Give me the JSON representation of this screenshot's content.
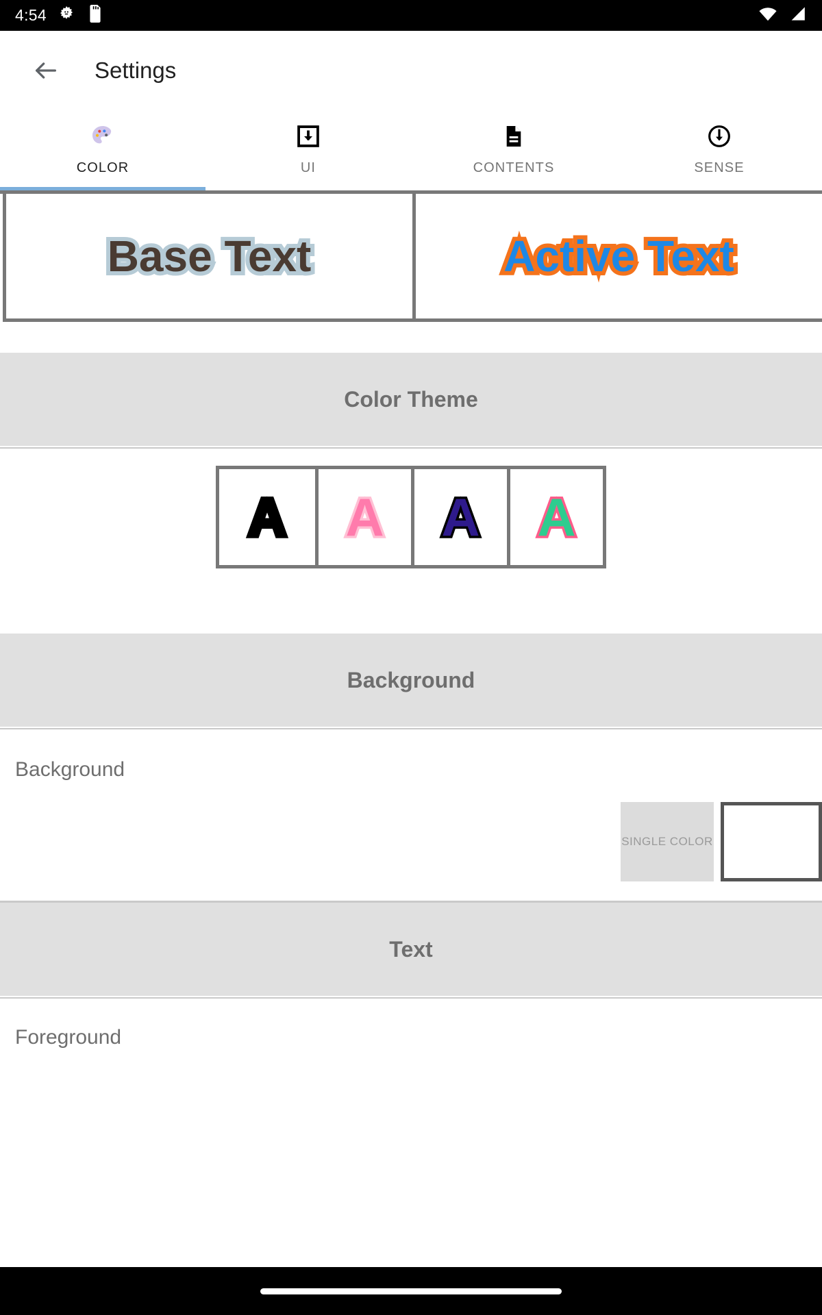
{
  "statusbar": {
    "time": "4:54",
    "icons": [
      "gear-icon",
      "sd-card-icon"
    ],
    "right_icons": [
      "wifi-icon",
      "cell-signal-icon"
    ]
  },
  "appbar": {
    "back_label": "Back",
    "title": "Settings"
  },
  "tabs": {
    "active_index": 0,
    "indicator_color": "#7BAEDB",
    "items": [
      {
        "label": "COLOR",
        "icon": "palette-icon"
      },
      {
        "label": "UI",
        "icon": "download-box-icon"
      },
      {
        "label": "CONTENTS",
        "icon": "document-icon"
      },
      {
        "label": "SENSE",
        "icon": "circle-down-arrow-icon"
      }
    ]
  },
  "preview": {
    "base": {
      "text": "Base Text",
      "fill_color": "#4A3B32",
      "outline_color": "#B6CBD6"
    },
    "active": {
      "text": "Active Text",
      "fill_color": "#1E88E5",
      "outline_color": "#F4731C"
    }
  },
  "sections": {
    "color_theme": {
      "title": "Color Theme",
      "swatches": [
        {
          "letter": "A",
          "fill_color": "#000000",
          "outline_color": "#000000",
          "name": "theme-black"
        },
        {
          "letter": "A",
          "fill_color": "#FF7BAC",
          "outline_color": "#FFC0D4",
          "name": "theme-pink"
        },
        {
          "letter": "A",
          "fill_color": "#2E1A8C",
          "outline_color": "#000000",
          "name": "theme-navy"
        },
        {
          "letter": "A",
          "fill_color": "#2ECC8F",
          "outline_color": "#FF5C8A",
          "name": "theme-green"
        }
      ]
    },
    "background": {
      "title": "Background",
      "row_label": "Background",
      "mode_button": "SINGLE COLOR",
      "chip_color": "#FFFFFF"
    },
    "text": {
      "title": "Text",
      "row_label": "Foreground"
    }
  },
  "navbar": {
    "pill": "home-indicator"
  }
}
